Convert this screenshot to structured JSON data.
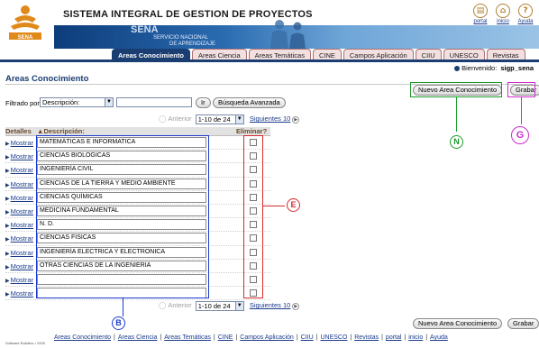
{
  "header": {
    "title": "SISTEMA INTEGRAL DE GESTION DE PROYECTOS",
    "brand": "SENA",
    "brand_sub_1": "SERVICIO NACIONAL",
    "brand_sub_2": "DE APRENDIZAJE",
    "links": [
      {
        "label": "portal",
        "icon": "book-icon"
      },
      {
        "label": "inicio",
        "icon": "home-icon"
      },
      {
        "label": "Ayuda",
        "icon": "help-icon"
      }
    ]
  },
  "tabs": [
    "Areas Conocimiento",
    "Areas Ciencia",
    "Areas Temáticas",
    "CINE",
    "Campos Aplicación",
    "CIIU",
    "UNESCO",
    "Revistas"
  ],
  "welcome": {
    "label": "Bienvenido:",
    "user": "sigp_sena"
  },
  "page_title": "Areas Conocimiento",
  "actions": {
    "new_label": "Nuevo Area Conocimiento",
    "save_label": "Grabar"
  },
  "filter": {
    "label": "Filtrado por",
    "field": "Descripción:",
    "value": "",
    "go_label": "Ir",
    "advanced_label": "Búsqueda Avanzada"
  },
  "pager": {
    "prev": "Anterior",
    "range": "1-10 de 24",
    "next": "Siguientes 10"
  },
  "grid": {
    "col_details": "Detalles",
    "col_description": "Descripción:",
    "col_delete": "Eliminar?",
    "show_label": "Mostrar",
    "rows": [
      "MATEMÁTICAS E INFORMATICA",
      "CIENCIAS BIOLOGICAS",
      "INGENIERÍA CIVIL",
      "CIENCIAS DE LA TIERRA Y MEDIO AMBIENTE",
      "CIENCIAS QUÍMICAS",
      "MEDICINA FUNDAMENTAL",
      "N. D.",
      "CIENCIAS FISICAS",
      "INGENIERÍA ELECTRICA Y ELECTRONICA",
      "OTRAS CIENCIAS DE LA INGENIERIA",
      "",
      ""
    ]
  },
  "annotations": {
    "N": "N",
    "G": "G",
    "E": "E",
    "B": "B"
  },
  "footer": {
    "links": [
      "Areas Conocimiento",
      "Areas Ciencia",
      "Areas Temáticas",
      "CINE",
      "Campos Aplicación",
      "CIIU",
      "UNESCO",
      "Revistas",
      "portal",
      "inicio",
      "Ayuda"
    ],
    "copyright": "Software Builders • 2005"
  },
  "colors": {
    "navy": "#1b3e72",
    "annotation_green": "#1a9a2a",
    "annotation_magenta": "#d02ad0",
    "annotation_red": "#d82a2a",
    "annotation_blue": "#1a3ad0"
  }
}
